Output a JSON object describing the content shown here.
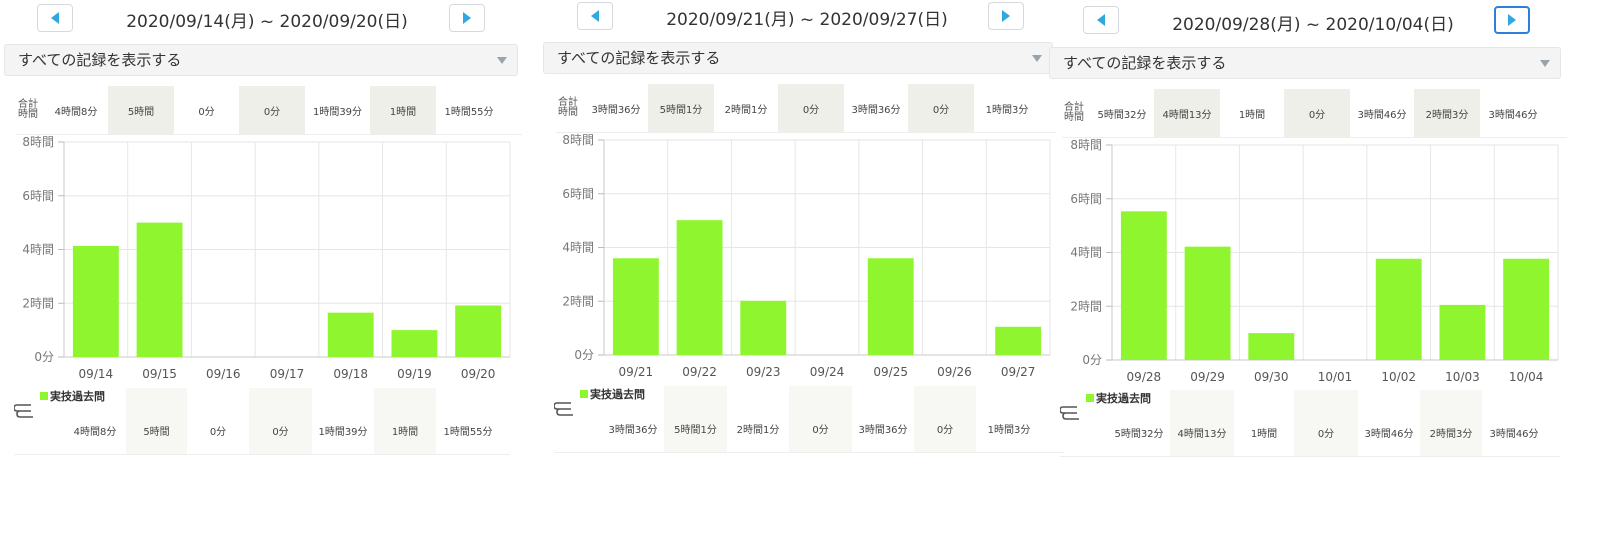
{
  "colors": {
    "bar": "#8ef52e",
    "shade": "#efefe9",
    "nav_arrow": "#2fa8e0",
    "active_border": "#2e7fd8"
  },
  "common": {
    "dropdown_label": "すべての記録を表示する",
    "total_label_1": "合計",
    "total_label_2": "時間",
    "legend_name": "実技過去問",
    "legend_icon": "record-book-icon"
  },
  "panels": [
    {
      "title": "2020/09/14(月) ~ 2020/09/20(日)",
      "totals": [
        "4時間8分",
        "5時間",
        "0分",
        "0分",
        "1時間39分",
        "1時間",
        "1時間55分"
      ],
      "legend_values": [
        "4時間8分",
        "5時間",
        "0分",
        "0分",
        "1時間39分",
        "1時間",
        "1時間55分"
      ]
    },
    {
      "title": "2020/09/21(月) ~ 2020/09/27(日)",
      "totals": [
        "3時間36分",
        "5時間1分",
        "2時間1分",
        "0分",
        "3時間36分",
        "0分",
        "1時間3分"
      ],
      "legend_values": [
        "3時間36分",
        "5時間1分",
        "2時間1分",
        "0分",
        "3時間36分",
        "0分",
        "1時間3分"
      ]
    },
    {
      "title": "2020/09/28(月) ~ 2020/10/04(日)",
      "totals": [
        "5時間32分",
        "4時間13分",
        "1時間",
        "0分",
        "3時間46分",
        "2時間3分",
        "3時間46分"
      ],
      "legend_values": [
        "5時間32分",
        "4時間13分",
        "1時間",
        "0分",
        "3時間46分",
        "2時間3分",
        "3時間46分"
      ]
    }
  ],
  "chart_data": [
    {
      "type": "bar",
      "categories": [
        "09/14",
        "09/15",
        "09/16",
        "09/17",
        "09/18",
        "09/19",
        "09/20"
      ],
      "series": [
        {
          "name": "実技過去問",
          "values": [
            4.133,
            5.0,
            0,
            0,
            1.65,
            1.0,
            1.917
          ]
        }
      ],
      "yticks": [
        "0分",
        "2時間",
        "4時間",
        "6時間",
        "8時間"
      ],
      "ylim": [
        0,
        8
      ],
      "grid": true,
      "legend": "bottom"
    },
    {
      "type": "bar",
      "categories": [
        "09/21",
        "09/22",
        "09/23",
        "09/24",
        "09/25",
        "09/26",
        "09/27"
      ],
      "series": [
        {
          "name": "実技過去問",
          "values": [
            3.6,
            5.017,
            2.017,
            0,
            3.6,
            0,
            1.05
          ]
        }
      ],
      "yticks": [
        "0分",
        "2時間",
        "4時間",
        "6時間",
        "8時間"
      ],
      "ylim": [
        0,
        8
      ],
      "grid": true,
      "legend": "bottom"
    },
    {
      "type": "bar",
      "categories": [
        "09/28",
        "09/29",
        "09/30",
        "10/01",
        "10/02",
        "10/03",
        "10/04"
      ],
      "series": [
        {
          "name": "実技過去問",
          "values": [
            5.533,
            4.217,
            1.0,
            0,
            3.767,
            2.05,
            3.767
          ]
        }
      ],
      "yticks": [
        "0分",
        "2時間",
        "4時間",
        "6時間",
        "8時間"
      ],
      "ylim": [
        0,
        8
      ],
      "grid": true,
      "legend": "bottom"
    }
  ]
}
